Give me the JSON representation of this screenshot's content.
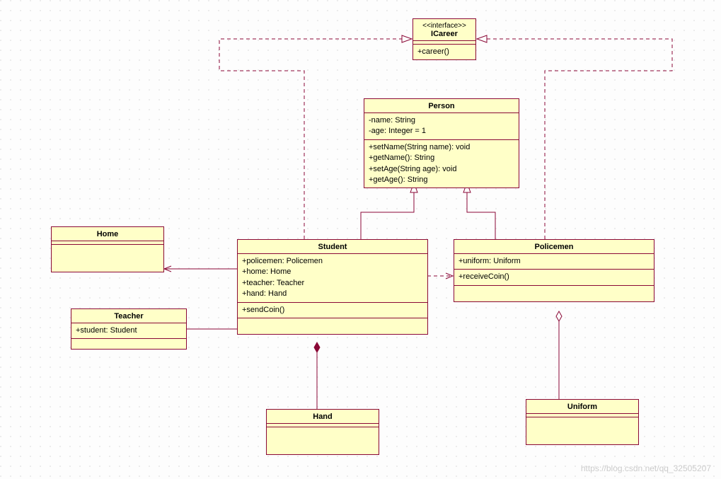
{
  "watermark": "https://blog.csdn.net/qq_32505207",
  "colors": {
    "fill": "#ffffc8",
    "border": "#8a0836",
    "bg": "#fdfdfd"
  },
  "classes": {
    "icareer": {
      "stereotype": "<<interface>>",
      "name": "ICareer",
      "methods": [
        "+career()"
      ]
    },
    "person": {
      "name": "Person",
      "attrs": [
        "-name: String",
        "-age: Integer = 1"
      ],
      "methods": [
        "+setName(String name): void",
        "+getName(): String",
        "+setAge(String age): void",
        "+getAge(): String"
      ]
    },
    "student": {
      "name": "Student",
      "attrs": [
        "+policemen: Policemen",
        "+home: Home",
        "+teacher: Teacher",
        "+hand: Hand"
      ],
      "methods": [
        "+sendCoin()"
      ]
    },
    "policemen": {
      "name": "Policemen",
      "attrs": [
        "+uniform: Uniform"
      ],
      "methods": [
        "+receiveCoin()"
      ]
    },
    "home": {
      "name": "Home"
    },
    "teacher": {
      "name": "Teacher",
      "attrs": [
        "+student: Student"
      ]
    },
    "hand": {
      "name": "Hand"
    },
    "uniform": {
      "name": "Uniform"
    }
  },
  "chart_data": {
    "type": "uml-class",
    "classes": [
      {
        "id": "icareer",
        "kind": "interface",
        "name": "ICareer",
        "methods": [
          "+career()"
        ]
      },
      {
        "id": "person",
        "kind": "class",
        "name": "Person",
        "attrs": [
          "-name: String",
          "-age: Integer = 1"
        ],
        "methods": [
          "+setName(String name): void",
          "+getName(): String",
          "+setAge(String age): void",
          "+getAge(): String"
        ]
      },
      {
        "id": "student",
        "kind": "class",
        "name": "Student",
        "attrs": [
          "+policemen: Policemen",
          "+home: Home",
          "+teacher: Teacher",
          "+hand: Hand"
        ],
        "methods": [
          "+sendCoin()"
        ]
      },
      {
        "id": "policemen",
        "kind": "class",
        "name": "Policemen",
        "attrs": [
          "+uniform: Uniform"
        ],
        "methods": [
          "+receiveCoin()"
        ]
      },
      {
        "id": "home",
        "kind": "class",
        "name": "Home"
      },
      {
        "id": "teacher",
        "kind": "class",
        "name": "Teacher",
        "attrs": [
          "+student: Student"
        ]
      },
      {
        "id": "hand",
        "kind": "class",
        "name": "Hand"
      },
      {
        "id": "uniform",
        "kind": "class",
        "name": "Uniform"
      }
    ],
    "relations": [
      {
        "from": "student",
        "to": "icareer",
        "type": "realization"
      },
      {
        "from": "policemen",
        "to": "icareer",
        "type": "realization"
      },
      {
        "from": "student",
        "to": "person",
        "type": "generalization"
      },
      {
        "from": "policemen",
        "to": "person",
        "type": "generalization"
      },
      {
        "from": "student",
        "to": "policemen",
        "type": "dependency"
      },
      {
        "from": "teacher",
        "to": "student",
        "type": "association"
      },
      {
        "from": "student",
        "to": "home",
        "type": "association-directed"
      },
      {
        "from": "student",
        "to": "hand",
        "type": "composition"
      },
      {
        "from": "policemen",
        "to": "uniform",
        "type": "aggregation"
      }
    ]
  }
}
